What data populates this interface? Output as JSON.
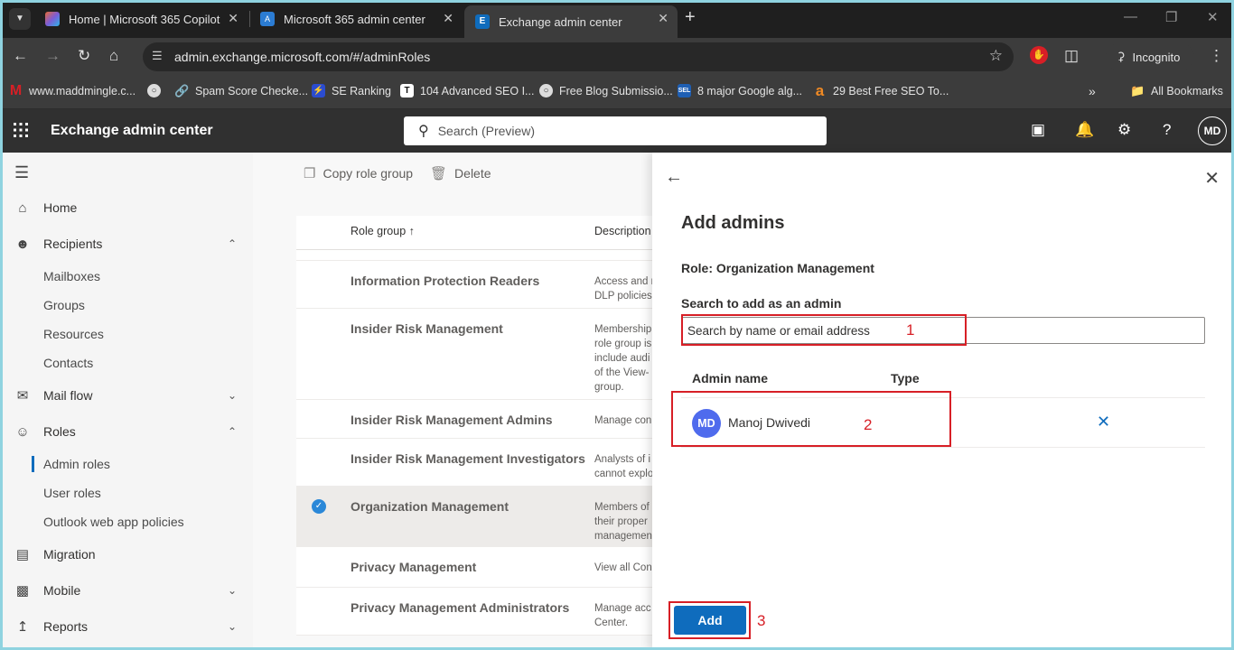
{
  "browser": {
    "tabs": [
      {
        "label": "Home | Microsoft 365 Copilot",
        "color": "#e86a34"
      },
      {
        "label": "Microsoft 365 admin center",
        "color": "#2b7cd3"
      },
      {
        "label": "Exchange admin center",
        "color": "#0f6cbd"
      }
    ],
    "url": "admin.exchange.microsoft.com/#/adminRoles",
    "incognito_label": "Incognito",
    "bookmarks": [
      {
        "label": "www.maddmingle.c...",
        "icon": "M",
        "color": "#d71f26"
      },
      {
        "label": "Spam Score Checke...",
        "icon": "link",
        "color": "#4a90d9"
      },
      {
        "label": "SE Ranking",
        "icon": "se",
        "color": "#2b4ccf"
      },
      {
        "label": "104 Advanced SEO I...",
        "icon": "T",
        "color": "#111"
      },
      {
        "label": "Free Blog Submissio...",
        "icon": "globe",
        "color": "#888"
      },
      {
        "label": "8 major Google alg...",
        "icon": "SEL",
        "color": "#1e5fb4"
      },
      {
        "label": "29 Best Free SEO To...",
        "icon": "a",
        "color": "#f08a24"
      }
    ],
    "all_bookmarks_label": "All Bookmarks"
  },
  "header": {
    "app_title": "Exchange admin center",
    "search_placeholder": "Search (Preview)",
    "avatar_initials": "MD"
  },
  "nav": {
    "items": [
      {
        "label": "Home"
      },
      {
        "label": "Recipients"
      },
      {
        "label": "Mailboxes"
      },
      {
        "label": "Groups"
      },
      {
        "label": "Resources"
      },
      {
        "label": "Contacts"
      },
      {
        "label": "Mail flow"
      },
      {
        "label": "Roles"
      },
      {
        "label": "Admin roles"
      },
      {
        "label": "User roles"
      },
      {
        "label": "Outlook web app policies"
      },
      {
        "label": "Migration"
      },
      {
        "label": "Mobile"
      },
      {
        "label": "Reports"
      }
    ]
  },
  "list": {
    "commands": {
      "copy": "Copy role group",
      "delete": "Delete"
    },
    "col_role_group": "Role group ↑",
    "col_description": "Description",
    "rows": [
      {
        "name": "Information Protection Readers",
        "desc": "Access and r DLP policies"
      },
      {
        "name": "Insider Risk Management",
        "desc": "Membership role group is include audi of the View- group."
      },
      {
        "name": "Insider Risk Management Admins",
        "desc": "Manage con"
      },
      {
        "name": "Insider Risk Management Investigators",
        "desc": "Analysts of i cannot explo"
      },
      {
        "name": "Organization Management",
        "desc": "Members of their proper managemen"
      },
      {
        "name": "Privacy Management",
        "desc": "View all Con"
      },
      {
        "name": "Privacy Management Administrators",
        "desc": "Manage acc Center."
      }
    ]
  },
  "panel": {
    "title": "Add admins",
    "role": "Role: Organization Management",
    "search_label": "Search to add as an admin",
    "search_placeholder": "Search by name or email address",
    "col_admin_name": "Admin name",
    "col_type": "Type",
    "admin": {
      "initials": "MD",
      "name": "Manoj Dwivedi"
    },
    "add_label": "Add"
  },
  "annotations": {
    "n1": "1",
    "n2": "2",
    "n3": "3"
  },
  "colors": {
    "accent": "#0f6cbd",
    "annotation": "#d71f26",
    "avatar": "#4f6bed"
  }
}
